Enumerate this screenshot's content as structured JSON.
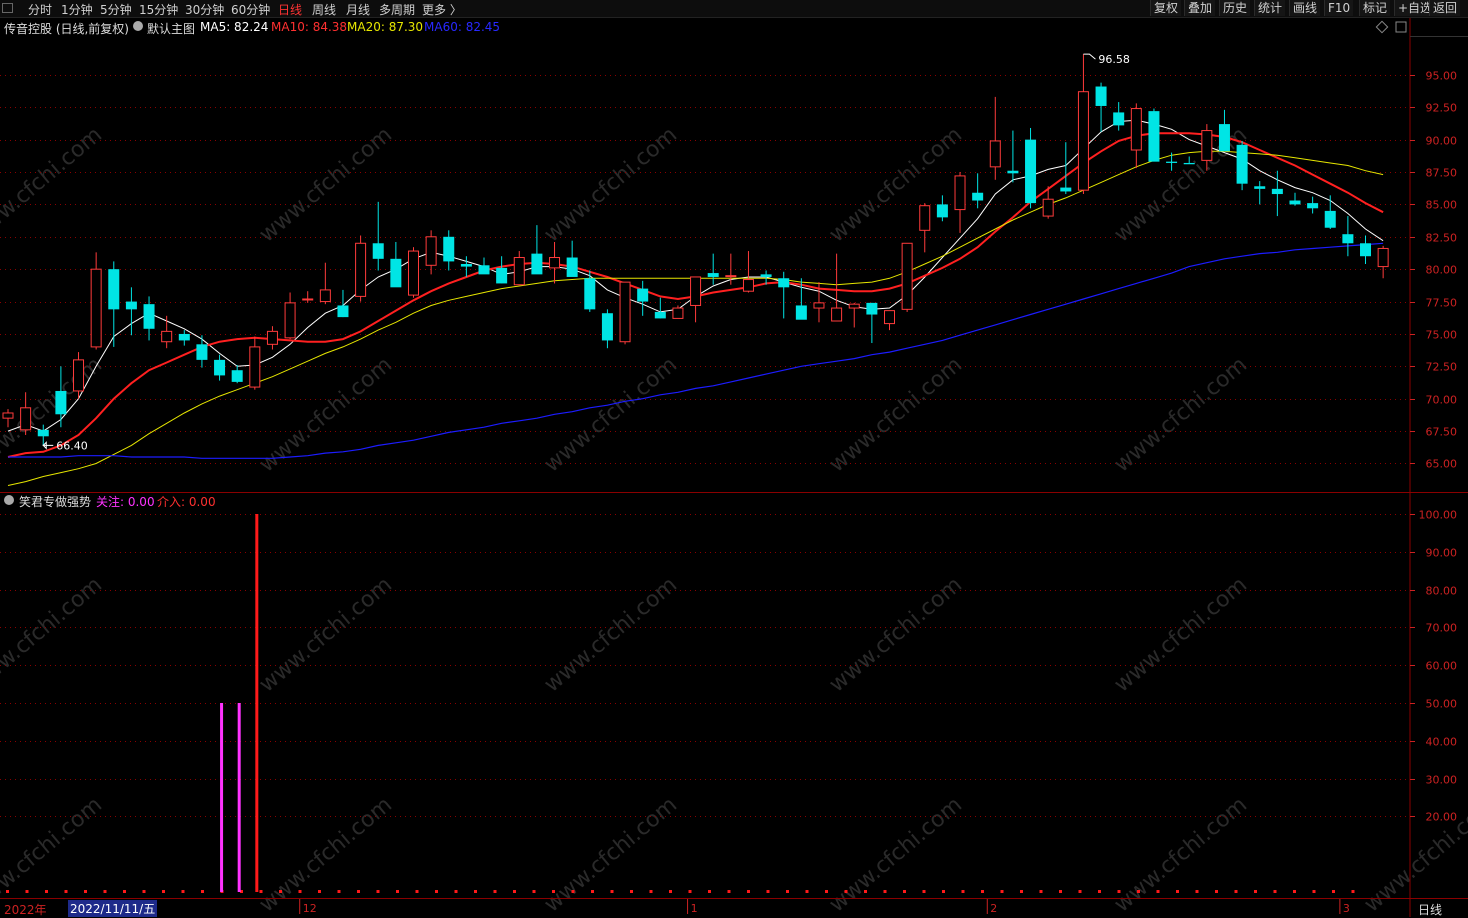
{
  "toolbar": {
    "tabs": [
      "分时",
      "1分钟",
      "5分钟",
      "15分钟",
      "30分钟",
      "60分钟",
      "日线",
      "周线",
      "月线",
      "多周期",
      "更多 〉"
    ],
    "active_tab": "日线",
    "right_buttons": [
      "复权",
      "叠加",
      "历史",
      "统计",
      "画线",
      "F10",
      "标记",
      "+自选",
      "返回"
    ]
  },
  "header": {
    "stock_name": "传音控股 (日线,前复权)",
    "indicator_name": "默认主图",
    "ma": [
      {
        "label": "MA5: 82.24",
        "color": "#ffffff"
      },
      {
        "label": "MA10: 84.38",
        "color": "#ff3030"
      },
      {
        "label": "MA20: 87.30",
        "color": "#e6e600"
      },
      {
        "label": "MA60: 82.45",
        "color": "#2828ff"
      }
    ]
  },
  "subheader": {
    "indicator_name": "笑君专做强势",
    "focus_label": "关注: 0.00",
    "entry_label": "介入: 0.00"
  },
  "colors": {
    "up": "#ff3b3b",
    "down": "#00e5e5",
    "grid": "#8a0000",
    "axis": "#cc2222",
    "ma5": "#ffffff",
    "ma10": "#ff2020",
    "ma20": "#e6e600",
    "ma60": "#1c1cff",
    "focus": "#ff33ff",
    "entry": "#ff1a1a"
  },
  "bottom_axis": {
    "year": "2022年",
    "selected_date": "2022/11/11/五",
    "months": [
      "12",
      "1",
      "2",
      "3"
    ],
    "period": "日线"
  },
  "chart_data": [
    {
      "type": "candlestick",
      "title": "传音控股 (日线,前复权)",
      "ylim": [
        62.8,
        98.0
      ],
      "yticks": [
        65.0,
        67.5,
        70.0,
        72.5,
        75.0,
        77.5,
        80.0,
        82.5,
        85.0,
        87.5,
        90.0,
        92.5,
        95.0
      ],
      "annotations": [
        {
          "label": "96.58",
          "index": 61
        },
        {
          "label": "66.40",
          "index": 2
        }
      ],
      "candles": [
        [
          68.5,
          69.2,
          67.8,
          68.9
        ],
        [
          67.6,
          70.5,
          67.2,
          69.3
        ],
        [
          67.6,
          68.0,
          66.4,
          67.1
        ],
        [
          70.6,
          72.5,
          67.8,
          68.8
        ],
        [
          70.6,
          73.6,
          70.0,
          73.0
        ],
        [
          74.0,
          81.3,
          73.8,
          80.0
        ],
        [
          80.0,
          80.6,
          74.0,
          76.9
        ],
        [
          77.5,
          78.6,
          74.9,
          76.9
        ],
        [
          77.3,
          77.9,
          74.5,
          75.4
        ],
        [
          74.4,
          76.4,
          73.9,
          75.2
        ],
        [
          75.0,
          75.3,
          74.1,
          74.5
        ],
        [
          74.2,
          74.9,
          72.4,
          73.0
        ],
        [
          73.0,
          73.4,
          71.4,
          71.8
        ],
        [
          72.2,
          72.6,
          71.2,
          71.3
        ],
        [
          70.9,
          74.8,
          70.7,
          74.0
        ],
        [
          74.2,
          75.6,
          73.8,
          75.2
        ],
        [
          74.7,
          78.2,
          74.6,
          77.4
        ],
        [
          77.7,
          78.3,
          77.4,
          77.7
        ],
        [
          77.5,
          80.5,
          77.3,
          78.4
        ],
        [
          77.2,
          78.4,
          76.3,
          76.3
        ],
        [
          77.9,
          82.6,
          77.5,
          82.0
        ],
        [
          82.0,
          85.2,
          79.9,
          80.8
        ],
        [
          80.8,
          82.1,
          79.4,
          78.6
        ],
        [
          78.0,
          81.7,
          77.8,
          81.4
        ],
        [
          80.3,
          83.0,
          79.6,
          82.5
        ],
        [
          82.5,
          83.0,
          79.9,
          80.6
        ],
        [
          80.4,
          81.0,
          79.4,
          80.2
        ],
        [
          80.3,
          80.9,
          79.7,
          79.6
        ],
        [
          80.1,
          81.0,
          78.9,
          78.9
        ],
        [
          78.8,
          81.4,
          78.8,
          80.9
        ],
        [
          81.2,
          83.4,
          80.2,
          79.6
        ],
        [
          80.1,
          82.1,
          78.9,
          80.9
        ],
        [
          80.9,
          82.2,
          79.9,
          79.4
        ],
        [
          79.3,
          79.9,
          76.7,
          76.9
        ],
        [
          76.6,
          76.9,
          73.9,
          74.5
        ],
        [
          74.4,
          78.6,
          74.2,
          79.0
        ],
        [
          78.5,
          79.1,
          76.4,
          77.5
        ],
        [
          76.7,
          77.8,
          76.2,
          76.2
        ],
        [
          76.2,
          77.2,
          76.2,
          77.0
        ],
        [
          77.2,
          78.6,
          75.9,
          79.4
        ],
        [
          79.7,
          81.2,
          78.8,
          79.4
        ],
        [
          79.5,
          81.2,
          78.8,
          79.5
        ],
        [
          78.3,
          81.4,
          78.2,
          79.2
        ],
        [
          79.6,
          79.9,
          78.8,
          79.4
        ],
        [
          79.3,
          79.8,
          76.2,
          78.6
        ],
        [
          77.2,
          79.3,
          76.2,
          76.1
        ],
        [
          77.0,
          79.0,
          75.9,
          77.4
        ],
        [
          76.0,
          81.2,
          76.0,
          77.0
        ],
        [
          77.0,
          77.4,
          75.5,
          77.3
        ],
        [
          77.4,
          77.4,
          74.3,
          76.5
        ],
        [
          75.8,
          76.7,
          75.3,
          76.8
        ],
        [
          76.9,
          82.0,
          76.7,
          82.0
        ],
        [
          83.0,
          85.1,
          81.3,
          84.9
        ],
        [
          85.0,
          85.7,
          83.7,
          84.0
        ],
        [
          84.6,
          87.5,
          82.8,
          87.2
        ],
        [
          85.9,
          87.4,
          84.7,
          85.3
        ],
        [
          87.9,
          93.3,
          86.9,
          89.9
        ],
        [
          87.6,
          90.7,
          86.7,
          87.4
        ],
        [
          90.0,
          90.9,
          84.7,
          85.1
        ],
        [
          84.1,
          86.4,
          83.9,
          85.4
        ],
        [
          86.3,
          89.8,
          85.8,
          86.0
        ],
        [
          86.1,
          96.6,
          85.8,
          93.7
        ],
        [
          94.1,
          94.4,
          90.6,
          92.6
        ],
        [
          92.1,
          92.9,
          90.7,
          91.1
        ],
        [
          89.2,
          92.8,
          87.8,
          92.4
        ],
        [
          92.2,
          92.4,
          88.6,
          88.3
        ],
        [
          88.3,
          89.0,
          87.6,
          88.2
        ],
        [
          88.2,
          88.7,
          88.2,
          88.1
        ],
        [
          88.4,
          91.2,
          87.6,
          90.7
        ],
        [
          91.2,
          92.3,
          89.7,
          89.1
        ],
        [
          89.6,
          89.9,
          86.1,
          86.6
        ],
        [
          86.4,
          86.8,
          85.0,
          86.2
        ],
        [
          86.2,
          87.6,
          84.1,
          85.8
        ],
        [
          85.3,
          85.9,
          84.9,
          85.0
        ],
        [
          85.1,
          85.6,
          84.3,
          84.7
        ],
        [
          84.5,
          85.7,
          83.1,
          83.2
        ],
        [
          82.7,
          84.1,
          81.0,
          82.0
        ],
        [
          82.0,
          82.6,
          80.4,
          81.0
        ],
        [
          80.2,
          81.8,
          79.3,
          81.6
        ]
      ],
      "series": [
        {
          "name": "MA5",
          "values": [
            67.5,
            68.0,
            67.5,
            68.4,
            70.0,
            72.5,
            74.8,
            75.8,
            76.6,
            76.0,
            75.4,
            74.6,
            73.5,
            72.5,
            72.6,
            73.2,
            74.2,
            75.5,
            76.6,
            77.2,
            78.4,
            79.4,
            80.0,
            80.8,
            81.3,
            81.0,
            80.6,
            80.2,
            79.6,
            79.8,
            80.2,
            80.2,
            80.0,
            79.5,
            78.4,
            77.8,
            77.3,
            76.7,
            76.9,
            77.9,
            78.7,
            79.2,
            79.4,
            79.4,
            79.0,
            78.6,
            78.3,
            77.6,
            77.1,
            76.9,
            77.0,
            78.0,
            79.4,
            80.9,
            82.4,
            83.9,
            85.8,
            86.9,
            87.2,
            87.7,
            88.0,
            89.3,
            90.6,
            91.4,
            91.5,
            91.2,
            90.8,
            90.0,
            89.5,
            89.0,
            88.5,
            87.6,
            86.9,
            86.3,
            85.9,
            85.3,
            84.3,
            83.1,
            82.2
          ]
        },
        {
          "name": "MA10",
          "values": [
            65.5,
            65.8,
            65.9,
            66.4,
            67.2,
            68.5,
            70.0,
            71.2,
            72.2,
            72.8,
            73.4,
            74.0,
            74.4,
            74.6,
            74.7,
            74.6,
            74.5,
            74.4,
            74.4,
            74.6,
            75.2,
            76.0,
            76.8,
            77.6,
            78.3,
            78.9,
            79.4,
            79.9,
            80.2,
            80.4,
            80.5,
            80.4,
            80.2,
            79.8,
            79.4,
            78.9,
            78.4,
            77.9,
            77.7,
            77.9,
            78.2,
            78.4,
            78.6,
            78.9,
            79.0,
            78.8,
            78.5,
            78.4,
            78.3,
            78.3,
            78.5,
            78.9,
            79.5,
            80.1,
            80.8,
            81.7,
            82.9,
            84.0,
            85.2,
            86.2,
            87.2,
            88.2,
            89.1,
            89.9,
            90.3,
            90.5,
            90.5,
            90.5,
            90.4,
            90.2,
            89.8,
            89.2,
            88.6,
            88.0,
            87.3,
            86.6,
            85.9,
            85.1,
            84.4
          ]
        },
        {
          "name": "MA20",
          "values": [
            63.3,
            63.6,
            64.0,
            64.3,
            64.6,
            65.0,
            65.7,
            66.4,
            67.3,
            68.1,
            68.9,
            69.6,
            70.2,
            70.7,
            71.2,
            71.7,
            72.3,
            72.9,
            73.5,
            74.0,
            74.6,
            75.3,
            75.9,
            76.6,
            77.2,
            77.6,
            77.9,
            78.2,
            78.5,
            78.7,
            78.9,
            79.1,
            79.2,
            79.3,
            79.3,
            79.3,
            79.3,
            79.3,
            79.3,
            79.3,
            79.3,
            79.3,
            79.3,
            79.3,
            79.2,
            79.0,
            78.9,
            78.8,
            78.9,
            79.0,
            79.3,
            79.8,
            80.4,
            81.0,
            81.7,
            82.4,
            83.1,
            83.8,
            84.4,
            85.0,
            85.5,
            86.1,
            86.7,
            87.3,
            87.9,
            88.4,
            88.8,
            89.0,
            89.1,
            89.1,
            89.0,
            88.9,
            88.8,
            88.6,
            88.4,
            88.2,
            88.0,
            87.6,
            87.3
          ]
        },
        {
          "name": "MA60",
          "values": [
            65.5,
            65.5,
            65.5,
            65.5,
            65.6,
            65.6,
            65.6,
            65.5,
            65.5,
            65.5,
            65.5,
            65.4,
            65.4,
            65.4,
            65.4,
            65.4,
            65.5,
            65.6,
            65.8,
            65.9,
            66.1,
            66.4,
            66.6,
            66.8,
            67.1,
            67.4,
            67.6,
            67.8,
            68.1,
            68.3,
            68.5,
            68.8,
            69.0,
            69.3,
            69.5,
            69.8,
            70.0,
            70.3,
            70.5,
            70.8,
            71.0,
            71.3,
            71.6,
            71.9,
            72.2,
            72.5,
            72.7,
            72.9,
            73.1,
            73.4,
            73.6,
            73.9,
            74.2,
            74.5,
            74.9,
            75.3,
            75.7,
            76.1,
            76.5,
            76.9,
            77.3,
            77.7,
            78.1,
            78.5,
            78.9,
            79.3,
            79.7,
            80.2,
            80.5,
            80.8,
            81.0,
            81.2,
            81.3,
            81.5,
            81.6,
            81.7,
            81.8,
            81.9,
            82.0
          ]
        }
      ]
    },
    {
      "type": "bar",
      "title": "笑君专做强势",
      "ylim": [
        0,
        100
      ],
      "yticks": [
        20,
        30,
        40,
        50,
        60,
        70,
        80,
        90,
        100
      ],
      "series": [
        {
          "name": "关注",
          "bars": [
            {
              "index": 12,
              "value": 50
            },
            {
              "index": 13,
              "value": 50
            }
          ]
        },
        {
          "name": "介入",
          "bars": [
            {
              "index": 14,
              "value": 100
            }
          ]
        }
      ]
    }
  ],
  "watermark": "www.cfchi.com"
}
